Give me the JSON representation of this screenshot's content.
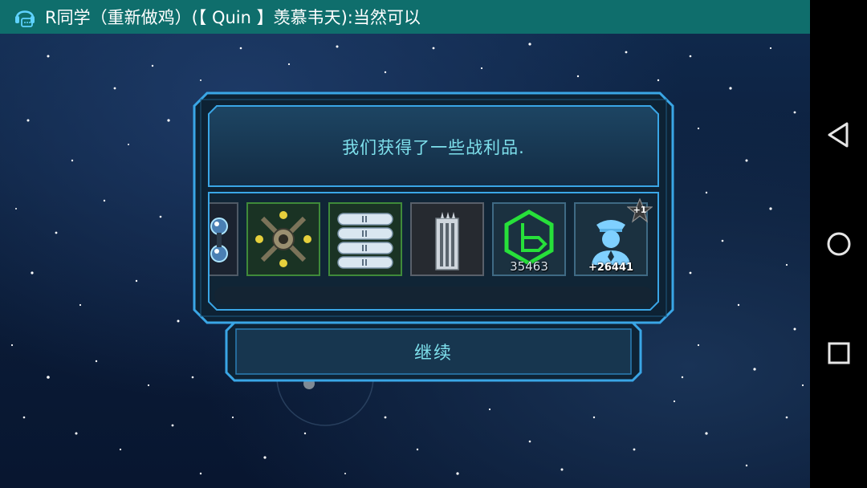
{
  "notification": {
    "text": "R同学（重新做鸡）(【 Quin 】羡慕韦天):当然可以",
    "icon": "chat-headset-icon"
  },
  "dialog": {
    "message": "我们获得了一些战利品.",
    "items": [
      {
        "name": "blue-orb-module",
        "count": ""
      },
      {
        "name": "cross-turret-module",
        "count": ""
      },
      {
        "name": "fuel-tanks-module",
        "count": ""
      },
      {
        "name": "missile-pod-module",
        "count": ""
      },
      {
        "name": "green-hex-credits",
        "count": "35463"
      },
      {
        "name": "crew-officer",
        "count": "+26441",
        "badge": "+1"
      }
    ],
    "continue_label": "继续"
  },
  "colors": {
    "notification_bg": "#0f6e6c",
    "panel_border": "#3aa6e6",
    "panel_fill": "#183a55",
    "text_cyan": "#7ee0ec",
    "credits_green": "#27e03a"
  },
  "navbar": {
    "back": "back-triangle-icon",
    "home": "home-circle-icon",
    "recents": "recents-square-icon"
  }
}
